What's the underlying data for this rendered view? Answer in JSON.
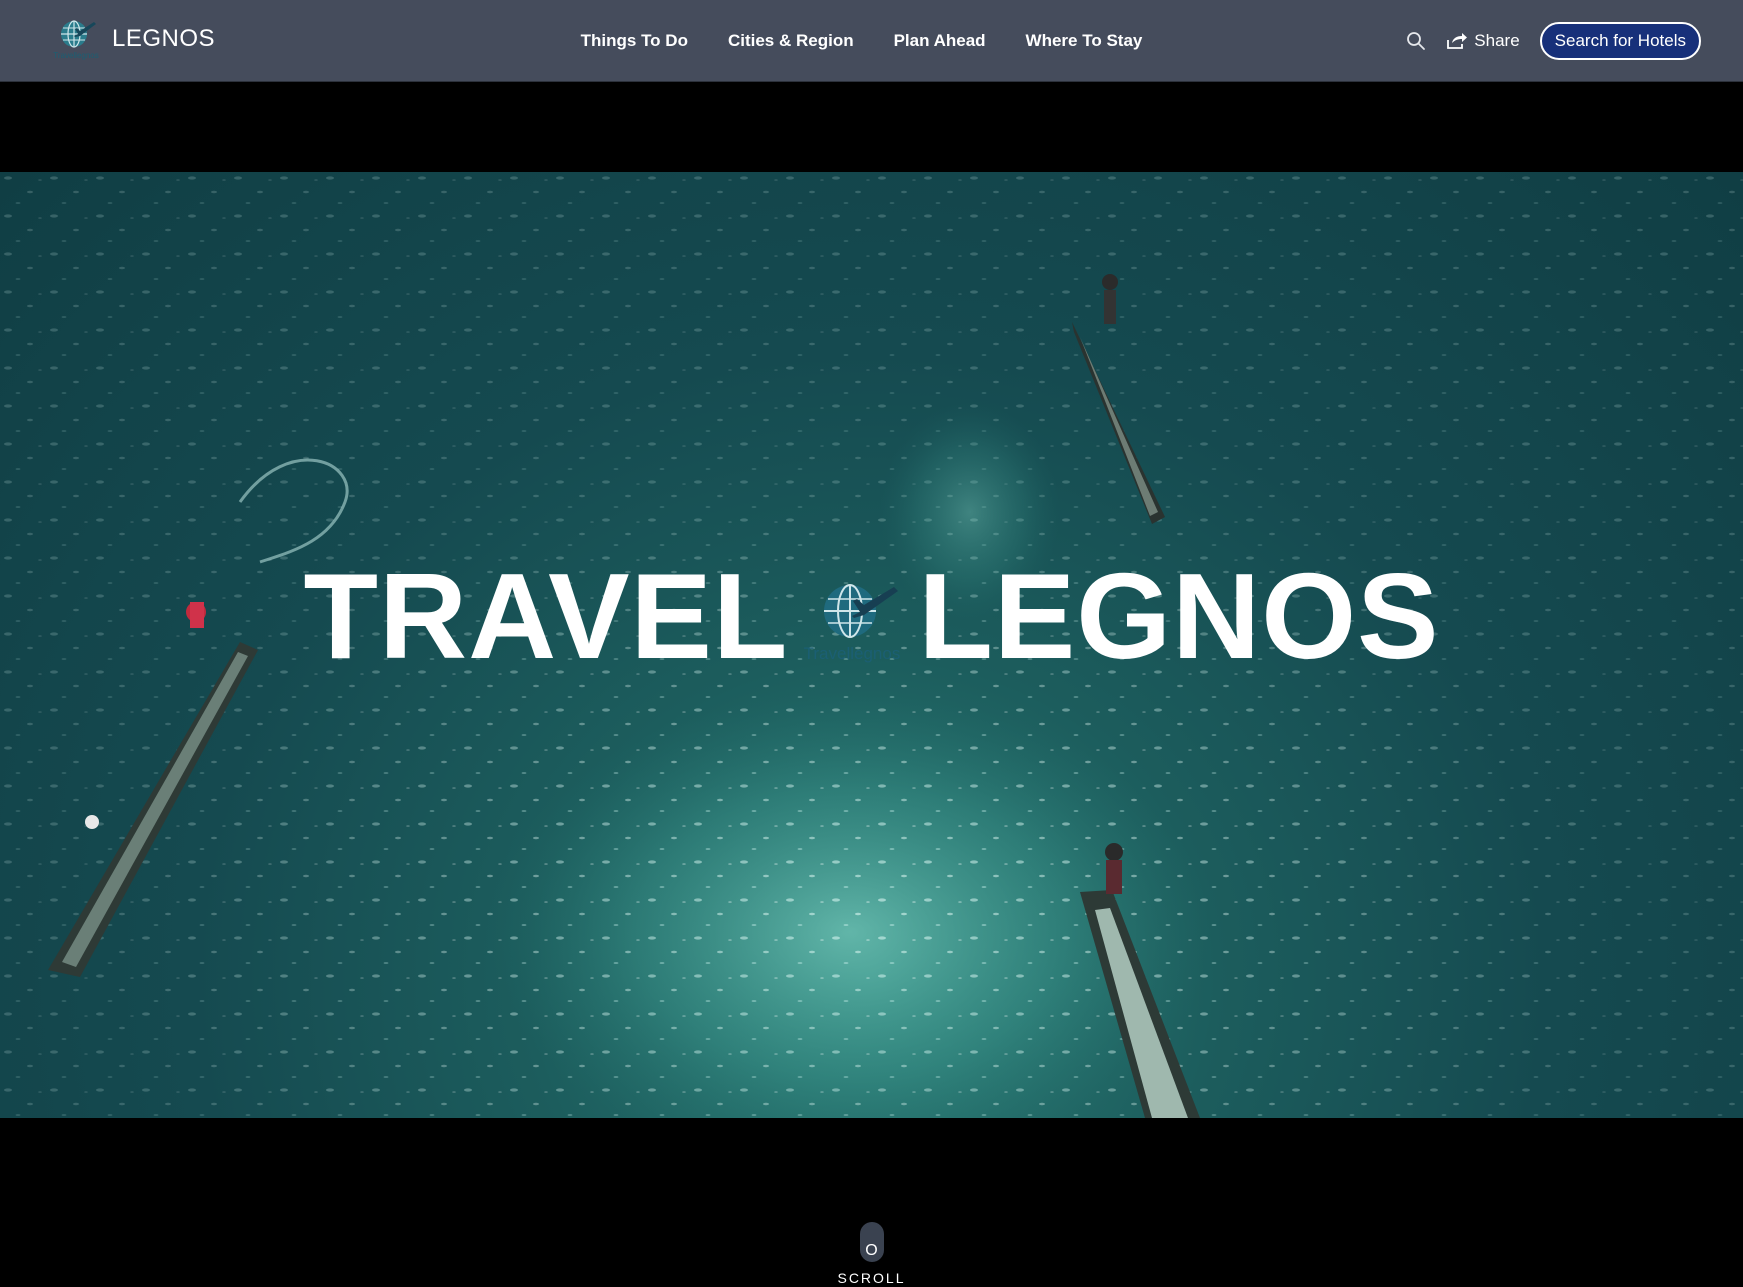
{
  "header": {
    "brand_name": "LEGNOS",
    "logo_text": "Travellegnos",
    "nav": [
      {
        "label": "Things To Do"
      },
      {
        "label": "Cities & Region"
      },
      {
        "label": "Plan Ahead"
      },
      {
        "label": "Where To Stay"
      }
    ],
    "search_icon": "search-icon",
    "share_icon": "share-icon",
    "share_label": "Share",
    "cta_label": "Search for Hotels"
  },
  "hero": {
    "left_word": "TRAVEL",
    "right_word": "LEGNOS",
    "logo_text": "Travellegnos"
  },
  "scroll": {
    "icon_glyph": "O",
    "label": "SCROLL"
  },
  "colors": {
    "header_bg": "#454c5c",
    "cta_bg": "#17307a",
    "logo_teal": "#1b5f73"
  }
}
